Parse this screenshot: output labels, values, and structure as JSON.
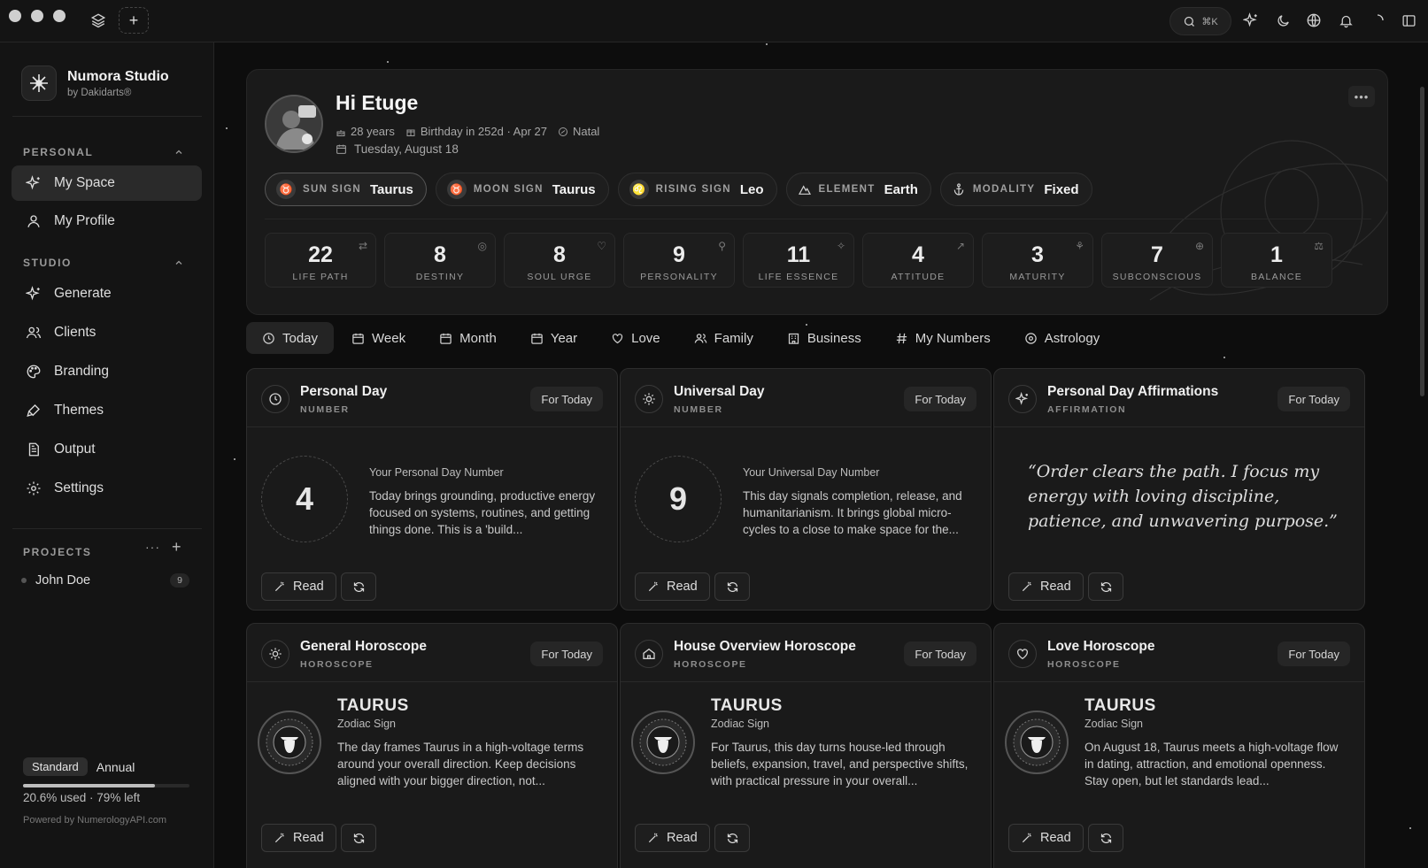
{
  "titlebar": {
    "search_shortcut": "⌘K"
  },
  "sidebar": {
    "brand_name": "Numora Studio",
    "brand_sub": "by Dakidarts®",
    "personal_label": "PERSONAL",
    "personal_items": [
      {
        "label": "My Space",
        "icon": "sparkles-icon"
      },
      {
        "label": "My Profile",
        "icon": "user-icon"
      }
    ],
    "studio_label": "STUDIO",
    "studio_items": [
      {
        "label": "Generate",
        "icon": "sparkles-icon"
      },
      {
        "label": "Clients",
        "icon": "users-icon"
      },
      {
        "label": "Branding",
        "icon": "palette-icon"
      },
      {
        "label": "Themes",
        "icon": "brush-icon"
      },
      {
        "label": "Output",
        "icon": "document-icon"
      },
      {
        "label": "Settings",
        "icon": "gear-icon"
      }
    ],
    "projects_label": "PROJECTS",
    "project": {
      "name": "John Doe",
      "count": "9"
    },
    "plan_badge": "Standard",
    "plan_period": "Annual",
    "usage_fraction": 0.794,
    "usage_text": "20.6% used · 79% left",
    "powered": "Powered by NumerologyAPI.com"
  },
  "hero": {
    "greeting": "Hi Etuge",
    "age": "28 years",
    "birthday": "Birthday in 252d · Apr 27",
    "chart": "Natal",
    "date": "Tuesday, August 18",
    "signs": [
      {
        "label": "SUN SIGN",
        "value": "Taurus",
        "icon": "♉"
      },
      {
        "label": "MOON SIGN",
        "value": "Taurus",
        "icon": "♉"
      },
      {
        "label": "RISING SIGN",
        "value": "Leo",
        "icon": "♌"
      },
      {
        "label": "ELEMENT",
        "value": "Earth",
        "icon": "mountain-icon"
      },
      {
        "label": "MODALITY",
        "value": "Fixed",
        "icon": "anchor-icon"
      }
    ],
    "numbers": [
      {
        "value": "22",
        "label": "LIFE PATH",
        "icon": "path-icon"
      },
      {
        "value": "8",
        "label": "DESTINY",
        "icon": "target-icon"
      },
      {
        "value": "8",
        "label": "SOUL URGE",
        "icon": "heart-icon"
      },
      {
        "value": "9",
        "label": "PERSONALITY",
        "icon": "user-icon"
      },
      {
        "value": "11",
        "label": "LIFE ESSENCE",
        "icon": "sparkles-icon"
      },
      {
        "value": "4",
        "label": "ATTITUDE",
        "icon": "trend-up-icon"
      },
      {
        "value": "3",
        "label": "MATURITY",
        "icon": "sprout-icon"
      },
      {
        "value": "7",
        "label": "SUBCONSCIOUS",
        "icon": "brain-icon"
      },
      {
        "value": "1",
        "label": "BALANCE",
        "icon": "scale-icon"
      }
    ]
  },
  "tabs": [
    {
      "label": "Today",
      "icon": "clock-icon"
    },
    {
      "label": "Week",
      "icon": "calendar-icon"
    },
    {
      "label": "Month",
      "icon": "calendar-icon"
    },
    {
      "label": "Year",
      "icon": "calendar-icon"
    },
    {
      "label": "Love",
      "icon": "heart-icon"
    },
    {
      "label": "Family",
      "icon": "users-icon"
    },
    {
      "label": "Business",
      "icon": "building-icon"
    },
    {
      "label": "My Numbers",
      "icon": "hash-icon"
    },
    {
      "label": "Astrology",
      "icon": "orbit-icon"
    }
  ],
  "cards": {
    "personal_day": {
      "title": "Personal Day",
      "sub": "NUMBER",
      "badge": "For Today",
      "number": "4",
      "kicker": "Your Personal Day Number",
      "body": "Today brings grounding, productive energy focused on systems, routines, and getting things done. This is a 'build..."
    },
    "universal_day": {
      "title": "Universal Day",
      "sub": "NUMBER",
      "badge": "For Today",
      "number": "9",
      "kicker": "Your Universal Day Number",
      "body": "This day signals completion, release, and humanitarianism. It brings global micro-cycles to a close to make space for the..."
    },
    "affirmation": {
      "title": "Personal Day Affirmations",
      "sub": "AFFIRMATION",
      "badge": "For Today",
      "quote": "“Order clears the path. I focus my energy with loving discipline, patience, and unwavering purpose.”"
    },
    "general": {
      "title": "General Horoscope",
      "sub": "HOROSCOPE",
      "badge": "For Today",
      "sign": "TAURUS",
      "sign_sub": "Zodiac Sign",
      "body": "The day frames Taurus in a high-voltage terms around your overall direction. Keep decisions aligned with your bigger direction, not..."
    },
    "house": {
      "title": "House Overview Horoscope",
      "sub": "HOROSCOPE",
      "badge": "For Today",
      "sign": "TAURUS",
      "sign_sub": "Zodiac Sign",
      "body": "For Taurus, this day turns house-led through beliefs, expansion, travel, and perspective shifts, with practical pressure in your overall..."
    },
    "love": {
      "title": "Love Horoscope",
      "sub": "HOROSCOPE",
      "badge": "For Today",
      "sign": "TAURUS",
      "sign_sub": "Zodiac Sign",
      "body": "On August 18, Taurus meets a high-voltage flow in dating, attraction, and emotional openness. Stay open, but let standards lead..."
    },
    "read_label": "Read"
  }
}
